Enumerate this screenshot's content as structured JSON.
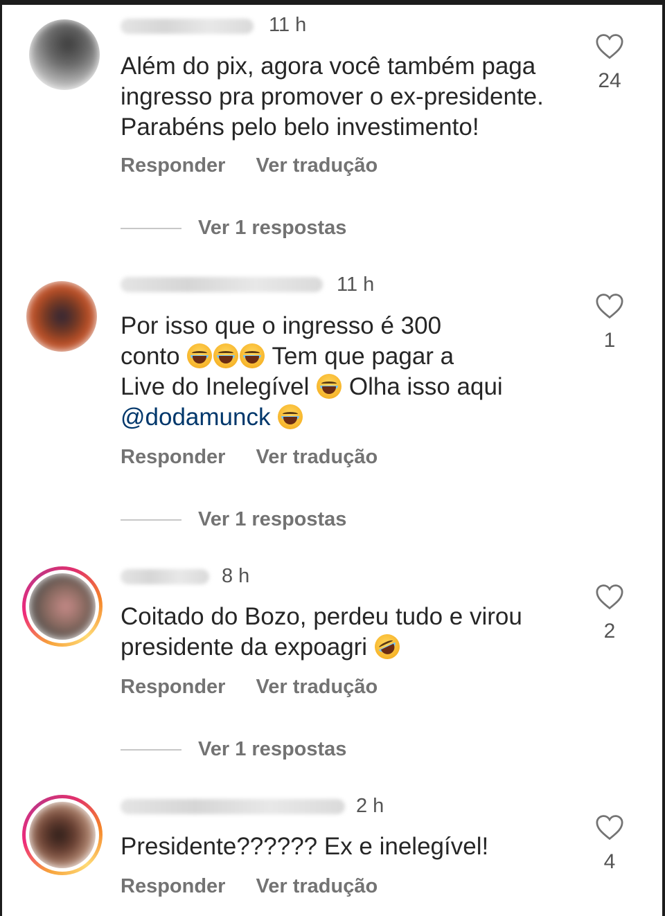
{
  "comments": [
    {
      "time": "11 h",
      "lines": [
        "Além do pix, agora você também paga",
        "ingresso pra promover o ex-presidente.",
        "Parabéns pelo belo investimento!"
      ],
      "like_count": "24",
      "reply_label": "Responder",
      "translate_label": "Ver tradução",
      "view_replies": "Ver 1 respostas"
    },
    {
      "time": "11 h",
      "line1": "Por isso que o ingresso é 300",
      "line2_text": "conto",
      "line2_rest": "Tem que pagar a",
      "line3_text": "Live do Inelegível",
      "line3_rest": "Olha isso aqui",
      "mention": "@dodamunck",
      "like_count": "1",
      "reply_label": "Responder",
      "translate_label": "Ver tradução",
      "view_replies": "Ver 1 respostas"
    },
    {
      "time": "8 h",
      "line1": "Coitado do Bozo, perdeu tudo e virou",
      "line2": "presidente da expoagri",
      "like_count": "2",
      "reply_label": "Responder",
      "translate_label": "Ver tradução",
      "view_replies": "Ver 1 respostas"
    },
    {
      "time": "2 h",
      "line1": "Presidente?????? Ex e inelegível!",
      "like_count": "4",
      "reply_label": "Responder",
      "translate_label": "Ver tradução"
    }
  ],
  "colors": {
    "text": "#262626",
    "secondary": "#737373",
    "mention": "#00376b",
    "story_ring": [
      "#f58529",
      "#dd2a7b",
      "#8134af"
    ]
  },
  "icons": {
    "like": "heart-outline-icon",
    "emoji_laugh": "tears-of-joy-emoji",
    "emoji_rofl": "rolling-on-floor-laughing-emoji"
  }
}
